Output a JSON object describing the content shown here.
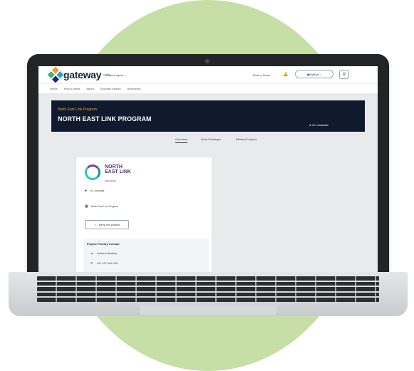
{
  "nav": {
    "logo_text": "gateway",
    "logo_sup": "by ICN",
    "explore_label": "Explore topics",
    "book_demo": "Book a Demo",
    "user_label": "MWhyo",
    "menu": [
      "Home",
      "How it works",
      "About",
      "Success Stories",
      "Resources"
    ]
  },
  "hero": {
    "subtitle": "North East Link Program",
    "title": "NORTH EAST LINK PROGRAM",
    "location": "VIC Australia"
  },
  "tabs": [
    "Overview",
    "Work Packages",
    "Related Projects"
  ],
  "card": {
    "brand_line1": "NORTH",
    "brand_line2": "EAST LINK",
    "brand_line3": "PROGRAM",
    "location": "VIC Australia",
    "org": "North East Link Program",
    "keep_posted": "Keep me posted",
    "contact_heading": "Project Primary Contact",
    "contact_name": "Andrew Bradley",
    "contact_phone": "+61 447 446 136"
  },
  "colors": {
    "hero_bg": "#101a2e",
    "accent_orange": "#f0a030",
    "brand_purple": "#5a2d8c",
    "brand_teal": "#2ec4c4",
    "bg_circle": "#c6dfa6"
  },
  "icons": [
    "gateway-logo-icon",
    "chevron-down-icon",
    "bell-icon",
    "user-globe-icon",
    "search-icon",
    "location-pin-icon",
    "building-icon",
    "star-icon",
    "person-icon",
    "phone-icon"
  ]
}
